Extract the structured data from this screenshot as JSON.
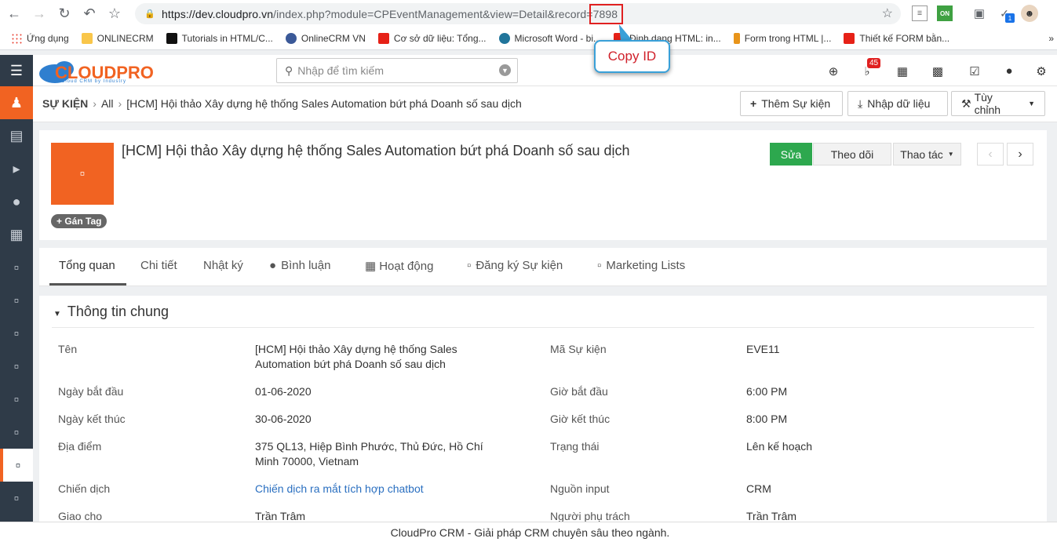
{
  "browser": {
    "url_main": "https://dev.cloudpro.vn",
    "url_rest": "/index.php?module=CPEventManagement&view=Detail&record=",
    "url_record": "7898",
    "ext_on_label": "ON",
    "profile_badge": "1"
  },
  "bookmarks": [
    {
      "label": "Ứng dụng",
      "color": "#4285f4"
    },
    {
      "label": "ONLINECRM",
      "color": "#f9c64a"
    },
    {
      "label": "Tutorials in HTML/C...",
      "color": "#111111"
    },
    {
      "label": "OnlineCRM VN",
      "color": "#3b5998"
    },
    {
      "label": "Cơ sở dữ liệu: Tổng...",
      "color": "#e62117"
    },
    {
      "label": "Microsoft Word - bi...",
      "color": "#21759b"
    },
    {
      "label": "Định dạng HTML: in...",
      "color": "#e62117"
    },
    {
      "label": "Form trong HTML |...",
      "color": "#e8941a"
    },
    {
      "label": "Thiết kế FORM bằn...",
      "color": "#e62117"
    }
  ],
  "bookmarks_more": "»",
  "callout": {
    "label": "Copy ID"
  },
  "app": {
    "logo_text": "CLOUDPRO",
    "logo_sub": "Cloud CRM by Industry",
    "search_placeholder": "Nhập để tìm kiếm",
    "notif_count": "45"
  },
  "breadcrumb": {
    "module": "SỰ KIỆN",
    "all": "All",
    "record": "[HCM] Hội thảo Xây dựng hệ thống Sales Automation bứt phá Doanh số sau dịch"
  },
  "toolbar": {
    "add": "Thêm Sự kiện",
    "import": "Nhập dữ liệu",
    "customize": "Tùy chỉnh"
  },
  "record": {
    "title": "[HCM] Hội thảo Xây dựng hệ thống Sales Automation bứt phá Doanh số sau dịch",
    "tag_label": "Gán Tag",
    "edit": "Sửa",
    "follow": "Theo dõi",
    "actions": "Thao tác"
  },
  "tabs": [
    "Tổng quan",
    "Chi tiết",
    "Nhật ký",
    "Bình luận",
    "Hoạt động",
    "Đăng ký Sự kiện",
    "Marketing Lists"
  ],
  "section": {
    "title": "Thông tin chung",
    "fields": {
      "name_label": "Tên",
      "name_line1": "[HCM] Hội thảo Xây dựng hệ thống Sales",
      "name_line2": "Automation bứt phá Doanh số sau dịch",
      "code_label": "Mã Sự kiện",
      "code_value": "EVE11",
      "start_date_label": "Ngày bắt đầu",
      "start_date_value": "01-06-2020",
      "start_time_label": "Giờ bắt đầu",
      "start_time_value": "6:00 PM",
      "end_date_label": "Ngày kết thúc",
      "end_date_value": "30-06-2020",
      "end_time_label": "Giờ kết thúc",
      "end_time_value": "8:00 PM",
      "location_label": "Địa điểm",
      "location_line1": "375 QL13, Hiệp Bình Phước, Thủ Đức, Hồ Chí",
      "location_line2": "Minh 70000, Vietnam",
      "status_label": "Trạng thái",
      "status_value": "Lên kế hoạch",
      "campaign_label": "Chiến dịch",
      "campaign_value": "Chiến dịch ra mắt tích hợp chatbot",
      "source_label": "Nguồn input",
      "source_value": "CRM",
      "assigned_label": "Giao cho",
      "assigned_value": "Trần Trâm",
      "owner_label": "Người phụ trách",
      "owner_value": "Trần Trâm"
    }
  },
  "footer": {
    "text": "CloudPro CRM - Giải pháp CRM chuyên sâu theo ngành."
  },
  "colors": {
    "brand": "#f16322",
    "sidebar": "#2f3b48",
    "edit": "#2da84e",
    "link": "#2a6fc0",
    "callout_border": "#39a0d8",
    "highlight": "#e02020"
  }
}
